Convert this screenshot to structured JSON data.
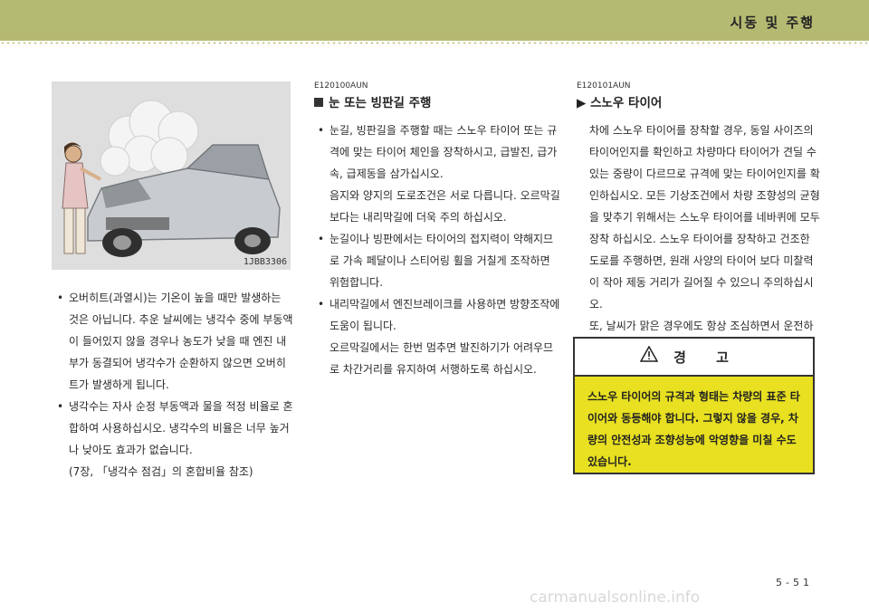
{
  "header": {
    "title": "시동 및 주행"
  },
  "photo": {
    "code": "1JBB3306"
  },
  "left": {
    "bullets": [
      "오버히트(과열시)는 기온이 높을 때만 발생하는 것은 아닙니다. 추운 날씨에는 냉각수 중에 부동액이 들어있지 않을 경우나 농도가 낮을 때 엔진 내부가 동결되어 냉각수가 순환하지 않으면 오버히트가 발생하게 됩니다.",
      "냉각수는 자사 순정 부동액과 물을 적정 비율로 혼합하여 사용하십시오. 냉각수의 비율은 너무 높거나 낮아도 효과가 없습니다."
    ],
    "note": "(7장, 「냉각수 점검」의 혼합비율 참조)"
  },
  "middle": {
    "code": "E120100AUN",
    "heading": "눈 또는 빙판길 주행",
    "bullet1": "눈길, 빙판길을 주행할 때는 스노우 타이어 또는 규격에 맞는 타이어 체인을 장착하시고, 급발진, 급가속, 급제동을 삼가십시오.",
    "para1": "음지와 양지의 도로조건은 서로 다릅니다. 오르막길 보다는 내리막길에 더욱 주의 하십시오.",
    "bullet2": "눈길이나 빙판에서는 타이어의 접지력이 약해지므로 가속 페달이나 스티어링 휠을 거칠게 조작하면 위험합니다.",
    "bullet3": "내리막길에서 엔진브레이크를 사용하면 방향조작에 도움이 됩니다.",
    "para2": "오르막길에서는 한번 멈추면 발진하기가 어려우므로 차간거리를 유지하여 서행하도록 하십시오."
  },
  "right": {
    "code": "E120101AUN",
    "heading": "▶ 스노우 타이어",
    "para1": "차에 스노우 타이어를 장착할 경우, 동일 사이즈의 타이어인지를 확인하고 차량마다 타이어가 견딜 수 있는 중량이 다르므로 규격에 맞는 타이어인지를 확인하십시오. 모든 기상조건에서 차량 조향성의 균형을 맞추기 위해서는 스노우 타이어를 네바퀴에 모두 장착 하십시오. 스노우 타이어를 장착하고 건조한 도로를 주행하면, 원래 사양의 타이어 보다 미찰력이 작아 제동 거리가 길어질 수 있으니 주의하십시오.",
    "para2": "또, 날씨가 맑은 경우에도 항상 조심하면서 운전하십시오."
  },
  "warning": {
    "title": "경 고",
    "text": "스노우 타이어의 규격과 형태는 차량의 표준 타이어와 동등해야 합니다. 그렇지 않을 경우, 차량의 안전성과 조향성능에 악영향을 미칠 수도 있습니다."
  },
  "footer": {
    "page": "5-51"
  },
  "watermark": "carmanualsonline.info"
}
